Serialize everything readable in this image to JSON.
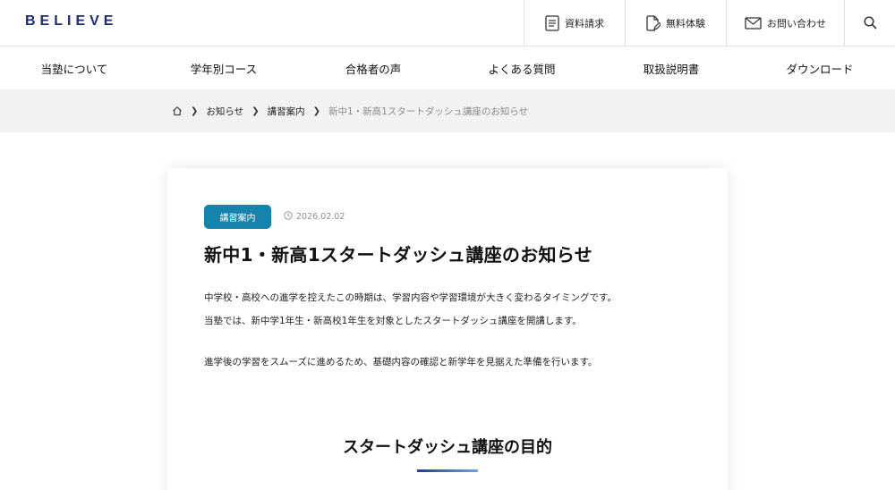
{
  "header": {
    "logo": "BELIEVE",
    "buttons": [
      {
        "label": "資料請求",
        "icon": "document-icon"
      },
      {
        "label": "無料体験",
        "icon": "pen-document-icon"
      },
      {
        "label": "お問い合わせ",
        "icon": "mail-icon"
      }
    ],
    "search_icon": "search-icon"
  },
  "nav": {
    "items": [
      "当塾について",
      "学年別コース",
      "合格者の声",
      "よくある質問",
      "取扱説明書",
      "ダウンロード"
    ]
  },
  "breadcrumb": {
    "home_icon": "home-icon",
    "items": [
      "お知らせ",
      "講習案内"
    ],
    "current": "新中1・新高1スタートダッシュ講座のお知らせ"
  },
  "article": {
    "category": "講習案内",
    "date": "2026.02.02",
    "title": "新中1・新高1スタートダッシュ講座のお知らせ",
    "paragraphs": [
      "中学校・高校への進学を控えたこの時期は、学習内容や学習環境が大きく変わるタイミングです。",
      "当塾では、新中学1年生・新高校1年生を対象としたスタートダッシュ講座を開講します。",
      "進学後の学習をスムーズに進めるため、基礎内容の確認と新学年を見据えた準備を行います。"
    ],
    "section_heading": "スタートダッシュ講座の目的"
  },
  "colors": {
    "logo": "#1d2c6b",
    "badge": "#1484ad",
    "breadcrumb_band": "#f2f2f2",
    "heading_bar_start": "#1d3f9a",
    "heading_bar_end": "#6aa3de"
  }
}
